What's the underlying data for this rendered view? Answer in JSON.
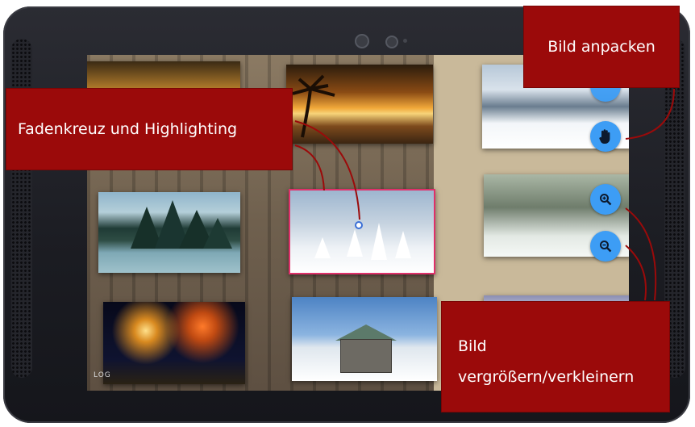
{
  "screen": {
    "log_label": "LOG"
  },
  "buttons": [
    {
      "name": "grab-button",
      "icon": "hand-icon"
    },
    {
      "name": "zoom-in-button",
      "icon": "zoom-in-icon"
    },
    {
      "name": "zoom-out-button",
      "icon": "zoom-out-icon"
    }
  ],
  "callouts": {
    "crosshair": "Fadenkreuz und Highlighting",
    "grab": "Bild anpacken",
    "zoom_line1": "Bild",
    "zoom_line2": "vergrößern/verkleinern"
  },
  "colors": {
    "callout_bg": "#9b0a0a",
    "button_blue": "#3d9df5",
    "highlight_border": "#e0306a",
    "connector_line": "#9b0a0a"
  }
}
